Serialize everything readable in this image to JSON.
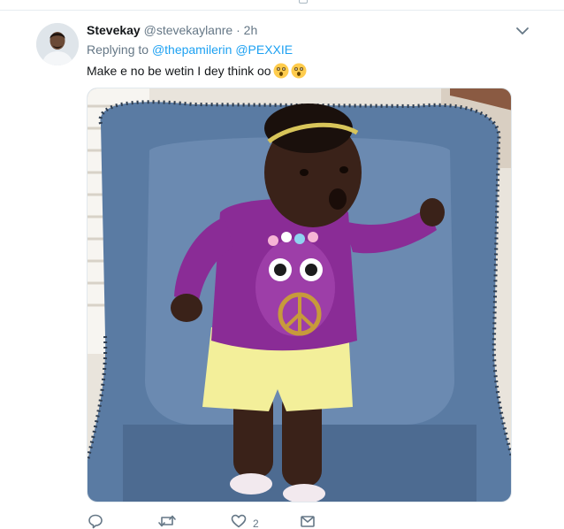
{
  "tweet": {
    "display_name": "Stevekay",
    "handle": "@stevekaylanre",
    "separator": "·",
    "time": "2h",
    "replying_label": "Replying to",
    "mentions": [
      "@thepamilerin",
      "@PEXXIE"
    ],
    "text": "Make e no be wetin I dey think oo",
    "emojis": [
      "astonished-face",
      "astonished-face"
    ]
  },
  "actions": {
    "reply_count": "",
    "retweet_count": "",
    "like_count": "2",
    "dm_count": ""
  },
  "colors": {
    "link": "#1da1f2",
    "secondary_text": "#657786",
    "primary_text": "#14171a",
    "border": "#e6ecf0"
  },
  "icons": [
    "reply-icon",
    "retweet-icon",
    "like-icon",
    "direct-message-icon",
    "chevron-down-icon"
  ]
}
